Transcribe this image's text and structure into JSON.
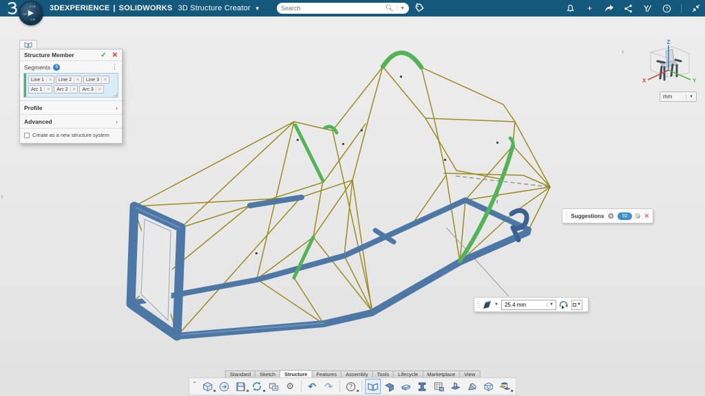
{
  "colors": {
    "topbar": "#14587b",
    "canvas": "#e9e9e9",
    "tube_blue": "#4d78a6",
    "wire_yellow": "#9a8c1e",
    "highlight_green": "#54b356",
    "badge_blue": "#2f7fbe",
    "axis_x": "#d04a3a",
    "axis_y": "#58b33e",
    "axis_z": "#2e86c8"
  },
  "topbar": {
    "brand": "3DEXPERIENCE",
    "separator": "|",
    "product": "SOLIDWORKS",
    "app_title": "3D Structure Creator",
    "search": {
      "placeholder": "Search"
    },
    "icons": [
      "tag-icon",
      "bell-icon",
      "add-icon",
      "share-arrow-icon",
      "share-nodes-icon",
      "signature-icon",
      "help-icon",
      "collapse-icon"
    ]
  },
  "panel": {
    "title": "Structure Member",
    "apply_glyph": "✓",
    "cancel_glyph": "✕",
    "segments_label": "Segments",
    "segments_count": "6",
    "chips": [
      "Line 1",
      "Line 2",
      "Line 3",
      "Arc 1",
      "Arc 2",
      "Arc 3"
    ],
    "profile_label": "Profile",
    "advanced_label": "Advanced",
    "checkbox_label": "Create as a new structure system"
  },
  "viewport": {
    "axis": {
      "x": "X",
      "y": "Y",
      "z": "Z"
    },
    "units_value": "mm",
    "suggestions": {
      "label": "Suggestions",
      "count": "92"
    },
    "dimension": {
      "value": "25.4 mm"
    }
  },
  "ribbon": {
    "tabs": [
      "Standard",
      "Sketch",
      "Structure",
      "Features",
      "Assembly",
      "Tools",
      "Lifecycle",
      "Marketplace",
      "View"
    ],
    "active_tab": "Structure"
  },
  "toolbar": {
    "icons": [
      "new-part-icon",
      "open-icon",
      "save-icon",
      "sync-icon",
      "swap-window-icon",
      "settings-gear-icon",
      "undo-icon",
      "redo-icon",
      "help-icon",
      "structure-member-icon",
      "corner-trim-icon",
      "panel-icon",
      "beam-icon",
      "member-table-icon",
      "gusset-icon",
      "corner-gusset-icon",
      "cube-icon",
      "pattern-icon"
    ],
    "selected_tool": "structure-member-icon"
  }
}
